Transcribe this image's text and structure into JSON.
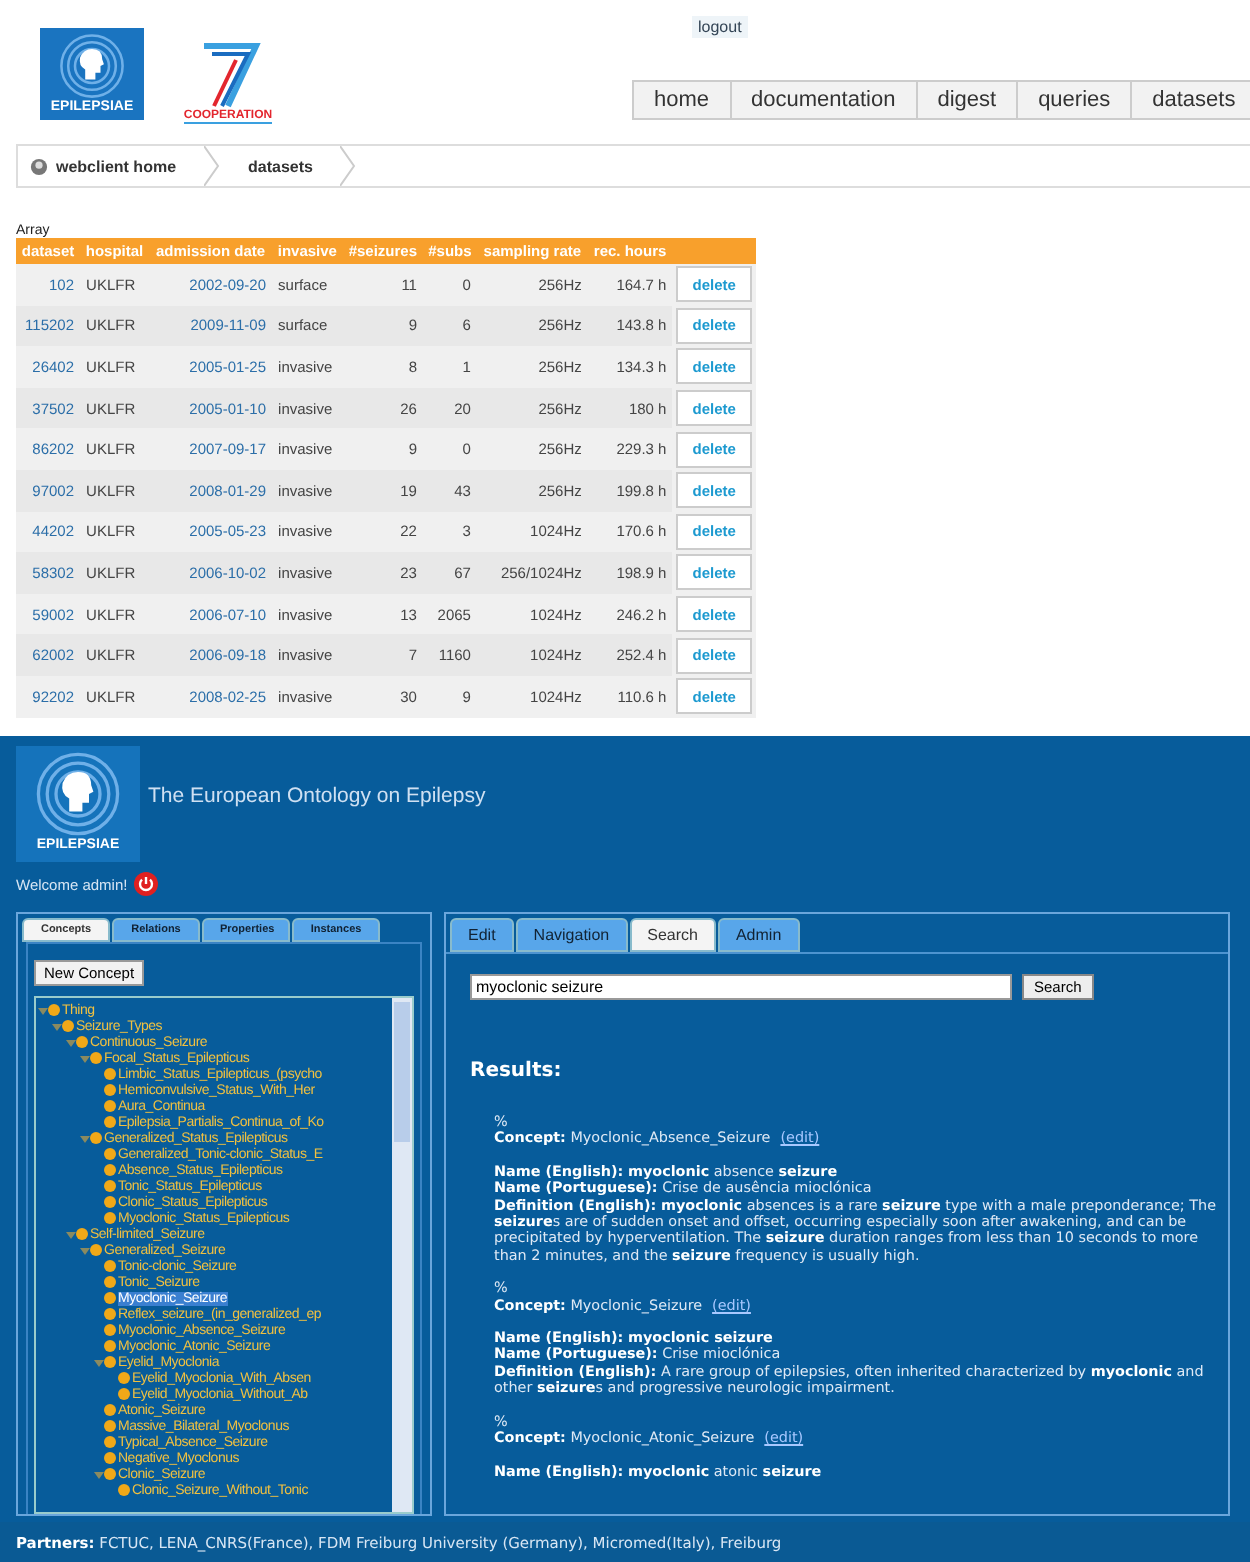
{
  "header": {
    "logout": "logout",
    "logos": [
      {
        "kind": "epilepsiae",
        "text": "EPILEPSIAE"
      },
      {
        "kind": "fp7",
        "text": "COOPERATION"
      }
    ]
  },
  "nav_tabs": [
    "home",
    "documentation",
    "digest",
    "queries",
    "datasets"
  ],
  "breadcrumb": [
    "webclient home",
    "datasets"
  ],
  "table": {
    "caption": "Array",
    "columns": [
      "dataset",
      "hospital",
      "admission date",
      "invasive",
      "#seizures",
      "#subs",
      "sampling rate",
      "rec. hours"
    ],
    "rows": [
      [
        "102",
        "UKLFR",
        "2002-09-20",
        "surface",
        "11",
        "0",
        "256Hz",
        "164.7 h",
        "delete"
      ],
      [
        "115202",
        "UKLFR",
        "2009-11-09",
        "surface",
        "9",
        "6",
        "256Hz",
        "143.8 h",
        "delete"
      ],
      [
        "26402",
        "UKLFR",
        "2005-01-25",
        "invasive",
        "8",
        "1",
        "256Hz",
        "134.3 h",
        "delete"
      ],
      [
        "37502",
        "UKLFR",
        "2005-01-10",
        "invasive",
        "26",
        "20",
        "256Hz",
        "180 h",
        "delete"
      ],
      [
        "86202",
        "UKLFR",
        "2007-09-17",
        "invasive",
        "9",
        "0",
        "256Hz",
        "229.3 h",
        "delete"
      ],
      [
        "97002",
        "UKLFR",
        "2008-01-29",
        "invasive",
        "19",
        "43",
        "256Hz",
        "199.8 h",
        "delete"
      ],
      [
        "44202",
        "UKLFR",
        "2005-05-23",
        "invasive",
        "22",
        "3",
        "1024Hz",
        "170.6 h",
        "delete"
      ],
      [
        "58302",
        "UKLFR",
        "2006-10-02",
        "invasive",
        "23",
        "67",
        "256/1024Hz",
        "198.9 h",
        "delete"
      ],
      [
        "59002",
        "UKLFR",
        "2006-07-10",
        "invasive",
        "13",
        "2065",
        "1024Hz",
        "246.2 h",
        "delete"
      ],
      [
        "62002",
        "UKLFR",
        "2006-09-18",
        "invasive",
        "7",
        "1160",
        "1024Hz",
        "252.4 h",
        "delete"
      ],
      [
        "92202",
        "UKLFR",
        "2008-02-25",
        "invasive",
        "30",
        "9",
        "1024Hz",
        "110.6 h",
        "delete"
      ]
    ]
  },
  "ontology": {
    "logo_text": "EPILEPSIAE",
    "title": "The European Ontology on Epilepsy",
    "welcome": "Welcome admin!",
    "left_tabs": [
      {
        "label": "Concepts",
        "selected": true
      },
      {
        "label": "Relations",
        "selected": false
      },
      {
        "label": "Properties",
        "selected": false
      },
      {
        "label": "Instances",
        "selected": false
      }
    ],
    "new_concept": "New Concept",
    "tree": [
      {
        "label": "Thing",
        "selected": false,
        "expanded": true,
        "children": [
          {
            "label": "Seizure_Types",
            "selected": false,
            "expanded": true,
            "children": [
              {
                "label": "Continuous_Seizure",
                "selected": false,
                "expanded": true,
                "children": [
                  {
                    "label": "Focal_Status_Epilepticus",
                    "selected": false,
                    "expanded": true,
                    "children": [
                      {
                        "label": "Limbic_Status_Epilepticus_(psycho",
                        "selected": false
                      },
                      {
                        "label": "Hemiconvulsive_Status_With_Her",
                        "selected": false
                      },
                      {
                        "label": "Aura_Continua",
                        "selected": false
                      },
                      {
                        "label": "Epilepsia_Partialis_Continua_of_Ko",
                        "selected": false
                      }
                    ]
                  },
                  {
                    "label": "Generalized_Status_Epilepticus",
                    "selected": false,
                    "expanded": true,
                    "children": [
                      {
                        "label": "Generalized_Tonic-clonic_Status_E",
                        "selected": false
                      },
                      {
                        "label": "Absence_Status_Epilepticus",
                        "selected": false
                      },
                      {
                        "label": "Tonic_Status_Epilepticus",
                        "selected": false
                      },
                      {
                        "label": "Clonic_Status_Epilepticus",
                        "selected": false
                      },
                      {
                        "label": "Myoclonic_Status_Epilepticus",
                        "selected": false
                      }
                    ]
                  }
                ]
              },
              {
                "label": "Self-limited_Seizure",
                "selected": false,
                "expanded": true,
                "children": [
                  {
                    "label": "Generalized_Seizure",
                    "selected": false,
                    "expanded": true,
                    "children": [
                      {
                        "label": "Tonic-clonic_Seizure",
                        "selected": false
                      },
                      {
                        "label": "Tonic_Seizure",
                        "selected": false
                      },
                      {
                        "label": "Myoclonic_Seizure",
                        "selected": true
                      },
                      {
                        "label": "Reflex_seizure_(in_generalized_ep",
                        "selected": false
                      },
                      {
                        "label": "Myoclonic_Absence_Seizure",
                        "selected": false
                      },
                      {
                        "label": "Myoclonic_Atonic_Seizure",
                        "selected": false
                      },
                      {
                        "label": "Eyelid_Myoclonia",
                        "selected": false,
                        "expanded": true,
                        "children": [
                          {
                            "label": "Eyelid_Myoclonia_With_Absen",
                            "selected": false
                          },
                          {
                            "label": "Eyelid_Myoclonia_Without_Ab",
                            "selected": false
                          }
                        ]
                      },
                      {
                        "label": "Atonic_Seizure",
                        "selected": false
                      },
                      {
                        "label": "Massive_Bilateral_Myoclonus",
                        "selected": false
                      },
                      {
                        "label": "Typical_Absence_Seizure",
                        "selected": false
                      },
                      {
                        "label": "Negative_Myoclonus",
                        "selected": false
                      },
                      {
                        "label": "Clonic_Seizure",
                        "selected": false,
                        "expanded": true,
                        "children": [
                          {
                            "label": "Clonic_Seizure_Without_Tonic",
                            "selected": false
                          }
                        ]
                      }
                    ]
                  }
                ]
              }
            ]
          }
        ]
      }
    ],
    "right_tabs": [
      {
        "label": "Edit",
        "selected": false
      },
      {
        "label": "Navigation",
        "selected": false
      },
      {
        "label": "Search",
        "selected": true
      },
      {
        "label": "Admin",
        "selected": false
      }
    ],
    "search": {
      "value": "myoclonic seizure",
      "button": "Search"
    },
    "results_heading": "Results:",
    "results": [
      {
        "marker": "%",
        "concept_label": "Concept:",
        "concept": "Myoclonic_Absence_Seizure",
        "edit": "(edit)",
        "fields": [
          {
            "label": "Name (English):",
            "text": "**myoclonic** absence **seizure**"
          },
          {
            "label": "Name (Portuguese):",
            "text": "Crise de ausência mioclónica"
          },
          {
            "label": "Definition (English):",
            "text": "**myoclonic** absences is a rare **seizure** type with a male preponderance; The **seizure**s are of sudden onset and offset, occurring especially soon after awakening, and can be precipitated by hyperventilation. The **seizure** duration ranges from less than 10 seconds to more than 2 minutes, and the **seizure** frequency is usually high."
          }
        ]
      },
      {
        "marker": "%",
        "concept_label": "Concept:",
        "concept": "Myoclonic_Seizure",
        "edit": "(edit)",
        "fields": [
          {
            "label": "Name (English):",
            "text": "**myoclonic seizure**"
          },
          {
            "label": "Name (Portuguese):",
            "text": "Crise mioclónica"
          },
          {
            "label": "Definition (English):",
            "text": "A rare group of epilepsies, often inherited characterized by **myoclonic** and other **seizure**s and progressive neurologic impairment."
          }
        ]
      },
      {
        "marker": "%",
        "concept_label": "Concept:",
        "concept": "Myoclonic_Atonic_Seizure",
        "edit": "(edit)",
        "fields": [
          {
            "label": "Name (English):",
            "text": "**myoclonic** atonic **seizure**"
          }
        ]
      }
    ]
  },
  "footer": {
    "label": "Partners:",
    "text": "FCTUC, LENA_CNRS(France), FDM Freiburg University (Germany), Micromed(Italy), Freiburg"
  }
}
